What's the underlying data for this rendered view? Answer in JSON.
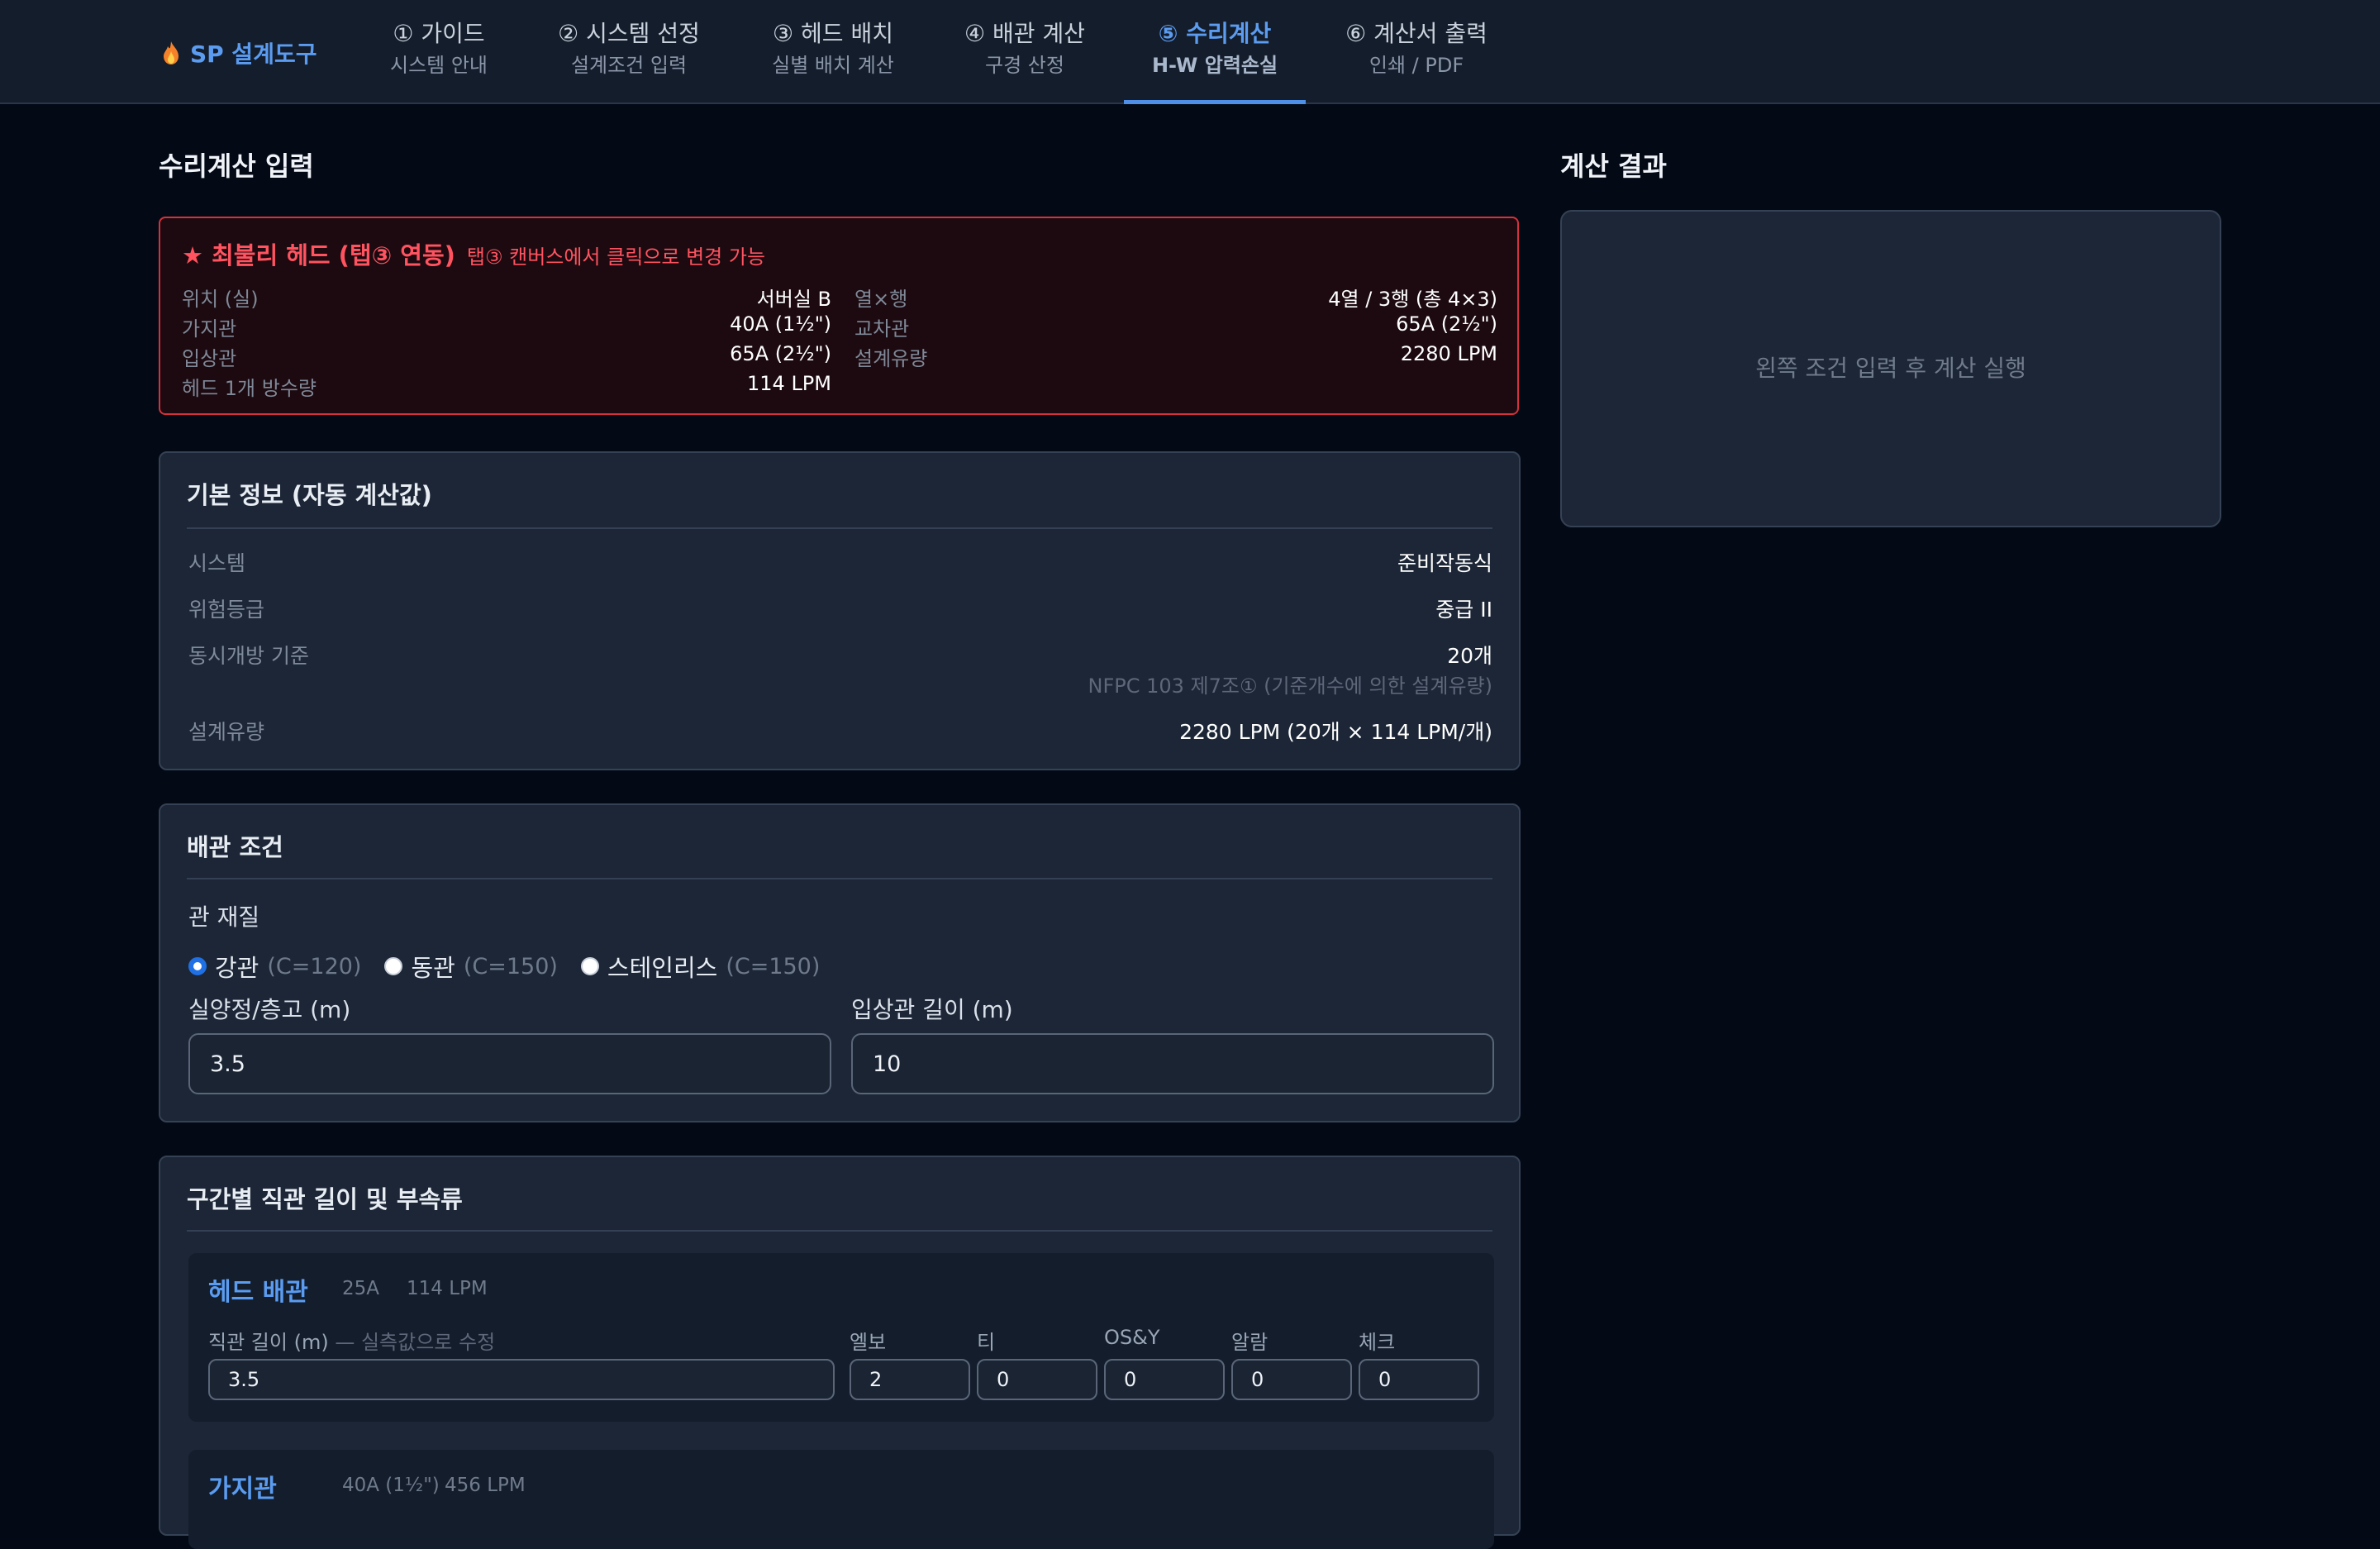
{
  "app": {
    "logo": "SP 설계도구"
  },
  "tabs": [
    {
      "title": "① 가이드",
      "sub": "시스템 안내"
    },
    {
      "title": "② 시스템 선정",
      "sub": "설계조건 입력"
    },
    {
      "title": "③ 헤드 배치",
      "sub": "실별 배치 계산"
    },
    {
      "title": "④ 배관 계산",
      "sub": "구경 산정"
    },
    {
      "title": "⑤ 수리계산",
      "sub": "H-W 압력손실"
    },
    {
      "title": "⑥ 계산서 출력",
      "sub": "인쇄 / PDF"
    }
  ],
  "active_tab": 4,
  "left_title": "수리계산 입력",
  "right_title": "계산 결과",
  "worst_head": {
    "title": "★ 최불리 헤드 (탭③ 연동)",
    "note": "탭③ 캔버스에서 클릭으로 변경 가능",
    "items": [
      {
        "label": "위치 (실)",
        "value": "서버실 B"
      },
      {
        "label": "열×행",
        "value": "4열 / 3행 (총 4×3)"
      },
      {
        "label": "가지관",
        "value": "40A (1½\")"
      },
      {
        "label": "교차관",
        "value": "65A (2½\")"
      },
      {
        "label": "입상관",
        "value": "65A (2½\")"
      },
      {
        "label": "설계유량",
        "value": "2280 LPM"
      },
      {
        "label": "헤드 1개 방수량",
        "value": "114 LPM"
      }
    ]
  },
  "basic": {
    "title": "기본 정보 (자동 계산값)",
    "rows": [
      {
        "label": "시스템",
        "value": "준비작동식"
      },
      {
        "label": "위험등급",
        "value": "중급 II"
      },
      {
        "label": "동시개방 기준",
        "value": "20개",
        "sub": "NFPC 103 제7조① (기준개수에 의한 설계유량)"
      },
      {
        "label": "설계유량",
        "value": "2280 LPM (20개 × 114 LPM/개)"
      }
    ]
  },
  "pipe": {
    "title": "배관 조건",
    "material_label": "관 재질",
    "materials": [
      {
        "name": "강관",
        "coef": "(C=120)",
        "checked": true
      },
      {
        "name": "동관",
        "coef": "(C=150)",
        "checked": false
      },
      {
        "name": "스테인리스",
        "coef": "(C=150)",
        "checked": false
      }
    ],
    "height_label": "실양정/층고 (m)",
    "height_value": "3.5",
    "riser_label": "입상관 길이 (m)",
    "riser_value": "10"
  },
  "sections": {
    "title": "구간별 직관 길이 및 부속류",
    "head_pipe": {
      "title": "헤드 배관",
      "size": "25A",
      "flow": "114 LPM",
      "length_label": "직관 길이 (m)",
      "length_hint": "— 실측값으로 수정",
      "length_value": "3.5",
      "fittings": [
        {
          "label": "엘보",
          "value": "2"
        },
        {
          "label": "티",
          "value": "0"
        },
        {
          "label": "OS&Y",
          "value": "0"
        },
        {
          "label": "알람",
          "value": "0"
        },
        {
          "label": "체크",
          "value": "0"
        }
      ]
    },
    "branch_pipe": {
      "title": "가지관",
      "size": "40A (1½\")",
      "flow": "456 LPM"
    }
  },
  "result": {
    "message": "왼쪽 조건 입력 후 계산 실행"
  },
  "colors": {
    "accent": "#5b9cf0",
    "danger": "#ff5360",
    "background": "#030a16",
    "card": "#1c2636"
  },
  "icons": {
    "logo": "flame-icon"
  }
}
